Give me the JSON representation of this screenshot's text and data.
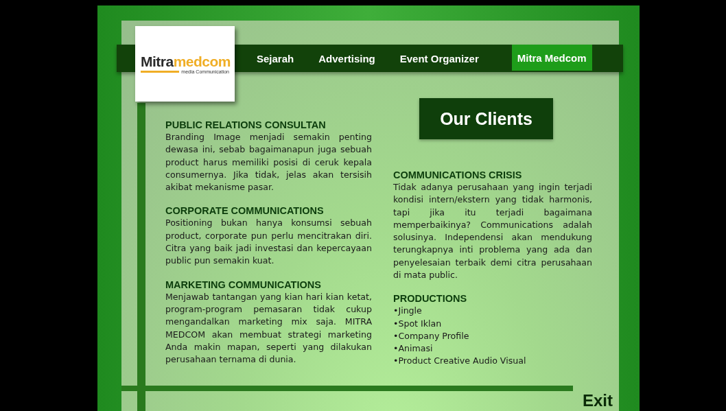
{
  "logo": {
    "primary": "Mitra",
    "secondary": "medcom",
    "tagline": "media Communication"
  },
  "tabs": [
    {
      "label": "Sejarah",
      "selected": false
    },
    {
      "label": "Advertising",
      "selected": false
    },
    {
      "label": "Event Organizer",
      "selected": false
    },
    {
      "label": "Mitra Medcom",
      "selected": true
    }
  ],
  "title": "Our Clients",
  "left_sections": [
    {
      "heading": "PUBLIC RELATIONS CONSULTAN",
      "body": "Branding Image menjadi semakin penting dewasa ini, sebab bagaimanapun juga sebuah product harus memiliki posisi di ceruk kepala consumernya. Jika tidak, jelas akan tersisih akibat mekanisme pasar."
    },
    {
      "heading": "CORPORATE COMMUNICATIONS",
      "body": "Positioning bukan hanya konsumsi sebuah product, corporate pun perlu mencitrakan diri. Citra yang baik jadi investasi dan kepercayaan public pun semakin kuat."
    },
    {
      "heading": "MARKETING COMMUNICATIONS",
      "body": "Menjawab tantangan yang kian hari kian ketat, program-program pemasaran tidak cukup mengandalkan marketing mix saja. MITRA MEDCOM akan membuat strategi marketing Anda makin mapan, seperti yang dilakukan perusahaan ternama di dunia."
    }
  ],
  "crisis": {
    "heading": "COMMUNICATIONS CRISIS",
    "body": "Tidak adanya perusahaan yang ingin terjadi kondisi intern/ekstern yang tidak harmonis, tapi jika itu terjadi bagaimana memperbaikinya? Communications adalah solusinya. Independensi akan mendukung terungkapnya inti problema yang ada dan penyelesaian terbaik demi citra perusahaan di mata public."
  },
  "productions": {
    "heading": "PRODUCTIONS",
    "items": [
      "•Jingle",
      "•Spot Iklan",
      "•Company Profile",
      "•Animasi",
      "•Product Creative Audio Visual"
    ]
  },
  "exit": "Exit"
}
